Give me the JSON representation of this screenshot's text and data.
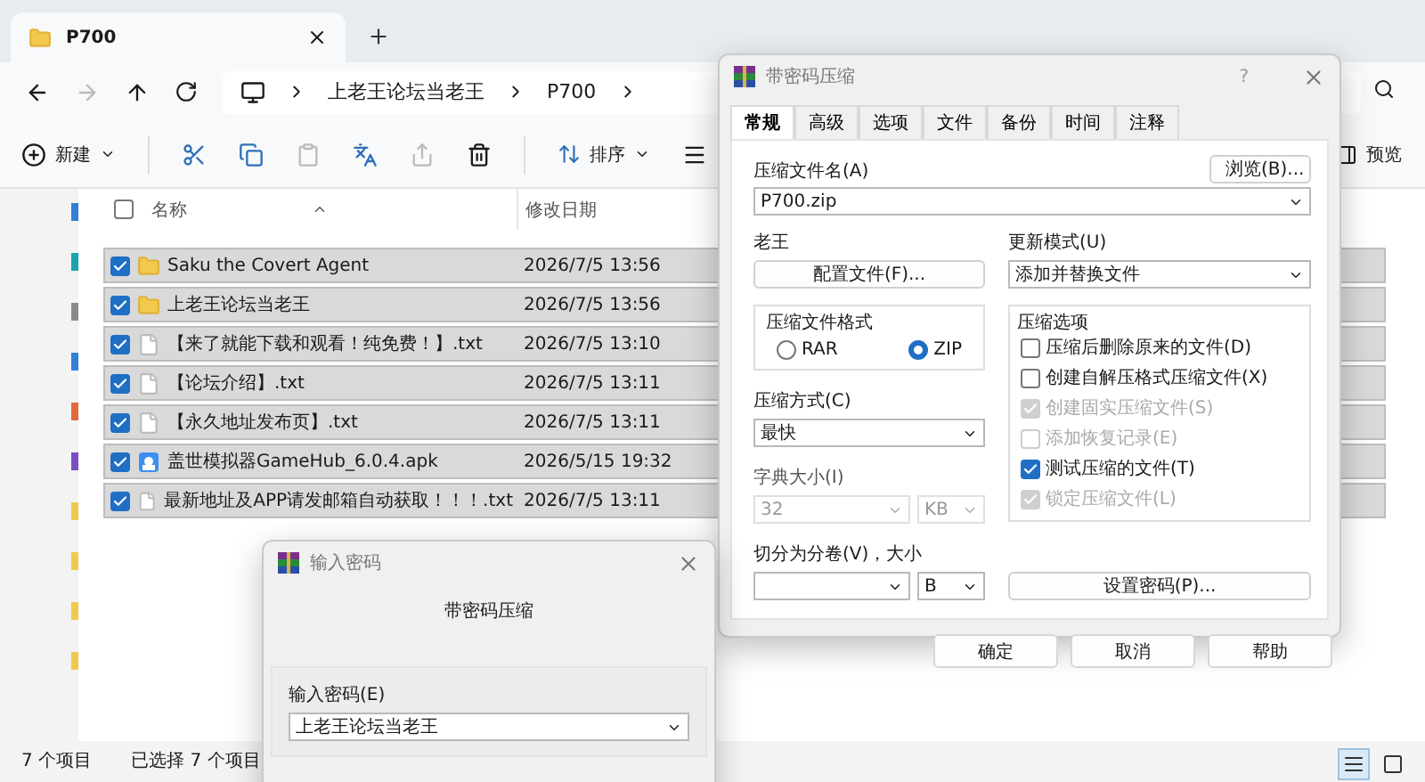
{
  "explorer": {
    "tab_title": "P700",
    "breadcrumb": [
      "上老王论坛当老王",
      "P700"
    ],
    "toolbar": {
      "new_label": "新建",
      "sort_label": "排序",
      "preview_label": "预览"
    },
    "columns": [
      "名称",
      "修改日期"
    ],
    "header_checked": false,
    "rows": [
      {
        "name": "Saku the Covert Agent",
        "date": "2026/7/5 13:56",
        "kind": "folder",
        "checked": true,
        "selected": true
      },
      {
        "name": "上老王论坛当老王",
        "date": "2026/7/5 13:56",
        "kind": "folder",
        "checked": true,
        "selected": true
      },
      {
        "name": "【来了就能下载和观看！纯免费！】.txt",
        "date": "2026/7/5 13:10",
        "kind": "text",
        "checked": true,
        "selected": true
      },
      {
        "name": "【论坛介绍】.txt",
        "date": "2026/7/5 13:11",
        "kind": "text",
        "checked": true,
        "selected": true
      },
      {
        "name": "【永久地址发布页】.txt",
        "date": "2026/7/5 13:11",
        "kind": "text",
        "checked": true,
        "selected": true
      },
      {
        "name": "盖世模拟器GameHub_6.0.4.apk",
        "date": "2026/5/15 19:32",
        "kind": "apk",
        "checked": true,
        "selected": true
      },
      {
        "name": "最新地址及APP请发邮箱自动获取！！！.txt",
        "date": "2026/7/5 13:11",
        "kind": "text",
        "checked": true,
        "selected": true
      }
    ],
    "status": [
      "7 个项目",
      "已选择 7 个项目"
    ],
    "views": [
      {
        "kind": "details",
        "selected": true
      },
      {
        "kind": "tiles",
        "selected": false
      }
    ]
  },
  "archive_dialog": {
    "title": "带密码压缩",
    "help": "?",
    "tabs": [
      {
        "label": "常规",
        "selected": true
      },
      {
        "label": "高级",
        "selected": false
      },
      {
        "label": "选项",
        "selected": false
      },
      {
        "label": "文件",
        "selected": false
      },
      {
        "label": "备份",
        "selected": false
      },
      {
        "label": "时间",
        "selected": false
      },
      {
        "label": "注释",
        "selected": false
      }
    ],
    "archive_name": {
      "label": "压缩文件名(A)",
      "value": "P700.zip",
      "browse": "浏览(B)..."
    },
    "profile": {
      "label": "老王",
      "button": "配置文件(F)..."
    },
    "update_mode": {
      "label": "更新模式(U)",
      "value": "添加并替换文件"
    },
    "format": {
      "title": "压缩文件格式",
      "options": [
        {
          "label": "RAR",
          "selected": false
        },
        {
          "label": "ZIP",
          "selected": true
        }
      ]
    },
    "method": {
      "label": "压缩方式(C)",
      "value": "最快"
    },
    "dictionary": {
      "label": "字典大小(I)",
      "value": "32",
      "unit": "KB",
      "disabled": true
    },
    "split": {
      "label": "切分为分卷(V)，大小",
      "unit": "B"
    },
    "options": {
      "title": "压缩选项",
      "items": [
        {
          "label": "压缩后删除原来的文件(D)",
          "checked": false,
          "disabled": false
        },
        {
          "label": "创建自解压格式压缩文件(X)",
          "checked": false,
          "disabled": false
        },
        {
          "label": "创建固实压缩文件(S)",
          "checked": true,
          "disabled": true
        },
        {
          "label": "添加恢复记录(E)",
          "checked": false,
          "disabled": true
        },
        {
          "label": "测试压缩的文件(T)",
          "checked": true,
          "disabled": false
        },
        {
          "label": "锁定压缩文件(L)",
          "checked": true,
          "disabled": true
        }
      ]
    },
    "set_password": "设置密码(P)...",
    "buttons": [
      "确定",
      "取消",
      "帮助"
    ]
  },
  "password_dialog": {
    "title": "输入密码",
    "subtitle": "带密码压缩",
    "label": "输入密码(E)",
    "value": "上老王论坛当老王"
  }
}
